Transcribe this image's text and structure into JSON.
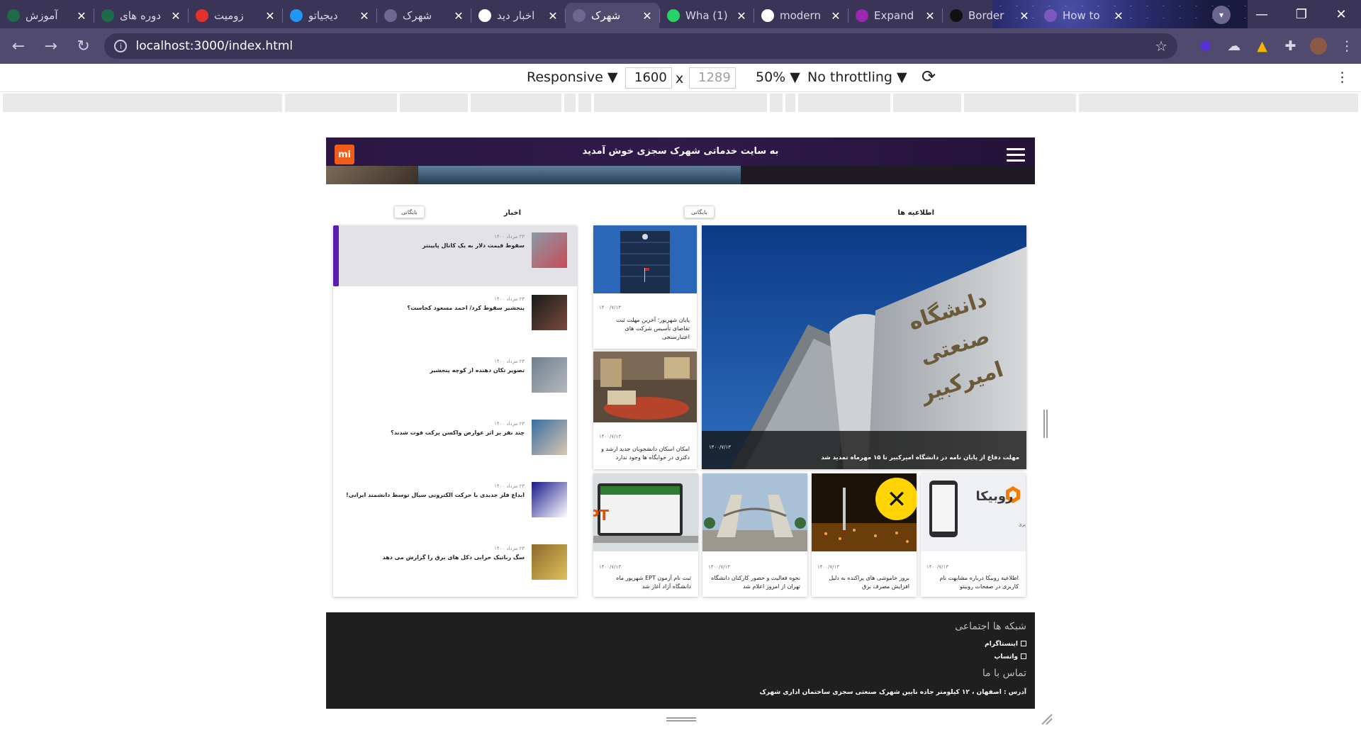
{
  "browser": {
    "tabs": [
      {
        "title": "آموزش",
        "favicon": "course-icon",
        "color": "#1e6b4a"
      },
      {
        "title": "دوره های",
        "favicon": "course-icon",
        "color": "#1e6b4a"
      },
      {
        "title": "زومیت",
        "favicon": "zoomit-icon",
        "color": "#e4312b"
      },
      {
        "title": "دیجیاتو",
        "favicon": "digiato-icon",
        "color": "#2196f3"
      },
      {
        "title": "شهرک",
        "favicon": "globe-icon",
        "color": "#6d6890"
      },
      {
        "title": "اخبار دید",
        "favicon": "google-icon",
        "color": "#ffffff"
      },
      {
        "title": "شهرک",
        "favicon": "globe-icon",
        "color": "#6d6890",
        "active": true
      },
      {
        "title": "(1) Wha",
        "favicon": "whatsapp-icon",
        "color": "#25d366"
      },
      {
        "title": "modern",
        "favicon": "google-icon",
        "color": "#ffffff"
      },
      {
        "title": "Expand",
        "favicon": "expand-icon",
        "color": "#9c27b0"
      },
      {
        "title": "Border",
        "favicon": "border-icon",
        "color": "#111111"
      },
      {
        "title": "How to",
        "favicon": "howto-icon",
        "color": "#7e57c2"
      }
    ],
    "close_glyph": "✕",
    "new_tab": "+",
    "window_controls": {
      "minimize": "—",
      "restore": "❐",
      "close": "✕"
    },
    "url": "localhost:3000/index.html"
  },
  "devtools": {
    "device": "Responsive",
    "width": "1600",
    "times": "x",
    "height": "1289",
    "zoom": "50%",
    "throttling": "No throttling",
    "more": "⋮"
  },
  "site": {
    "logo": "mi",
    "title": "به سایت خدماتی شهرک سجزی خوش آمدید",
    "announcements": {
      "title": "اطلاعیه ها",
      "archive": "بایگانی",
      "feature": {
        "date": "۱۴۰۰/۷/۱۳",
        "caption": "مهلت دفاع از پایان نامه در دانشگاه امیرکبیر تا ۱۵ مهرماه تمدید شد",
        "image_text": "دانشگاه صنعتی امیرکبیر (پلی تکنیک تهران)"
      },
      "cards": [
        {
          "date": "۱۴۰۰/۷/۱۳",
          "caption": "پایان شهریور؛ آخرین مهلت ثبت تقاضای تأسیس شرکت های اعتبارسنجی"
        },
        {
          "date": "۱۴۰۰/۷/۱۳",
          "caption": "امکان اسکان دانشجویان جدید ارشد و دکتری در خوابگاه ها وجود ندارد"
        },
        {
          "date": "۱۴۰۰/۷/۱۳",
          "caption": "اطلاعیه روبیکا درباره مشابهت نام کاربری در صفحات روبیتو",
          "image_text": "روبیکا",
          "image_sub": "اطلاعیه رسمی روبیکا پیرامون فرآیند ثبت شناسه کاربری"
        },
        {
          "date": "۱۴۰۰/۷/۱۳",
          "caption": "بروز خاموشی های پراکنده به دلیل افزایش مصرف برق"
        },
        {
          "date": "۱۴۰۰/۷/۱۳",
          "caption": "نحوه فعالیت و حضور کارکنان دانشگاه تهران از امروز اعلام شد"
        },
        {
          "date": "۱۴۰۰/۷/۱۳",
          "caption": "ثبت نام آزمون EPT شهریور ماه دانشگاه آزاد آغاز شد",
          "image_text": "EPT"
        }
      ]
    },
    "news": {
      "title": "اخبار",
      "archive": "بایگانی",
      "items": [
        {
          "date": "۲۳ مرداد ۱۴۰۰",
          "title": "سقوط قیمت دلار به یک کانال پایینتر"
        },
        {
          "date": "۲۳ مرداد ۱۴۰۰",
          "title": "پنجشیر سقوط کرد/ احمد مسعود کجاست؟"
        },
        {
          "date": "۲۳ مرداد ۱۴۰۰",
          "title": "تصویر تکان دهنده از کوچه پنجشیر"
        },
        {
          "date": "۲۳ مرداد ۱۴۰۰",
          "title": "چند نفر بر اثر عوارض واکسن برکت فوت شدند؟"
        },
        {
          "date": "۲۳ مرداد ۱۴۰۰",
          "title": "ابداع فلز جدیدی با حرکت الکترونی سیال توسط دانشمند ایرانی!"
        },
        {
          "date": "۲۳ مرداد ۱۴۰۰",
          "title": "سگ رباتیک خرابی دکل های برق را گزارش می دهد"
        }
      ]
    },
    "footer": {
      "social_title": "شبکه ها اجتماعی",
      "instagram": "اینستاگرام",
      "whatsapp": "واتساپ",
      "contact_title": "تماس با ما",
      "address": "آدرس : اصفهان ، ۱۲ کیلومتر جاده نایین شهرک صنعتی سجزی ساختمان اداری شهرک"
    }
  }
}
